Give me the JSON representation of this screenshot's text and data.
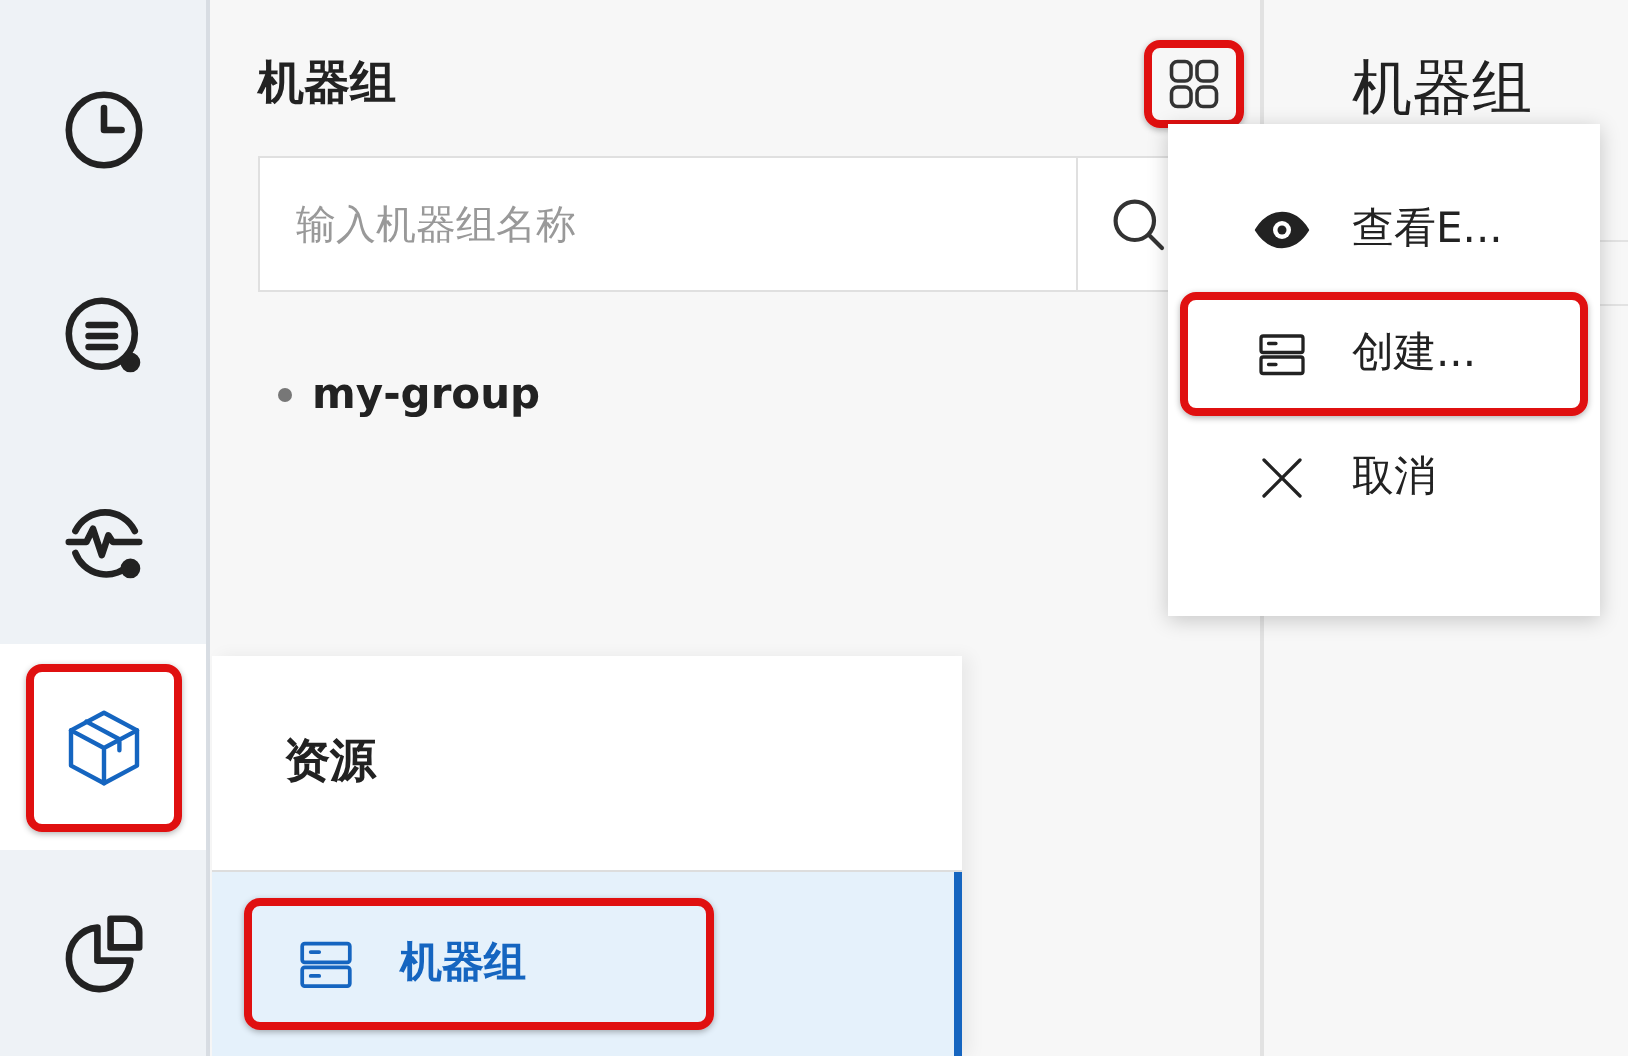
{
  "rail": [
    {
      "kind": "clock",
      "selected": false,
      "highlighted": false
    },
    {
      "kind": "search-list",
      "selected": false,
      "highlighted": false
    },
    {
      "kind": "search-pulse",
      "selected": false,
      "highlighted": false
    },
    {
      "kind": "cube",
      "selected": true,
      "highlighted": true
    },
    {
      "kind": "pie",
      "selected": false,
      "highlighted": false
    }
  ],
  "panel": {
    "title": "机器组",
    "grid_button": {
      "highlighted": true
    },
    "search": {
      "placeholder": "输入机器组名称"
    },
    "groups": [
      {
        "label": "my-group"
      }
    ]
  },
  "flyout": {
    "title": "资源",
    "items": [
      {
        "label": "机器组",
        "kind": "server",
        "selected": true,
        "highlighted": true
      }
    ]
  },
  "menu": {
    "items": [
      {
        "label": "查看E...",
        "kind": "eye",
        "highlighted": false
      },
      {
        "label": "创建...",
        "kind": "server",
        "highlighted": true
      },
      {
        "label": "取消",
        "kind": "close",
        "highlighted": false
      }
    ]
  },
  "detail": {
    "title": "机器组"
  }
}
